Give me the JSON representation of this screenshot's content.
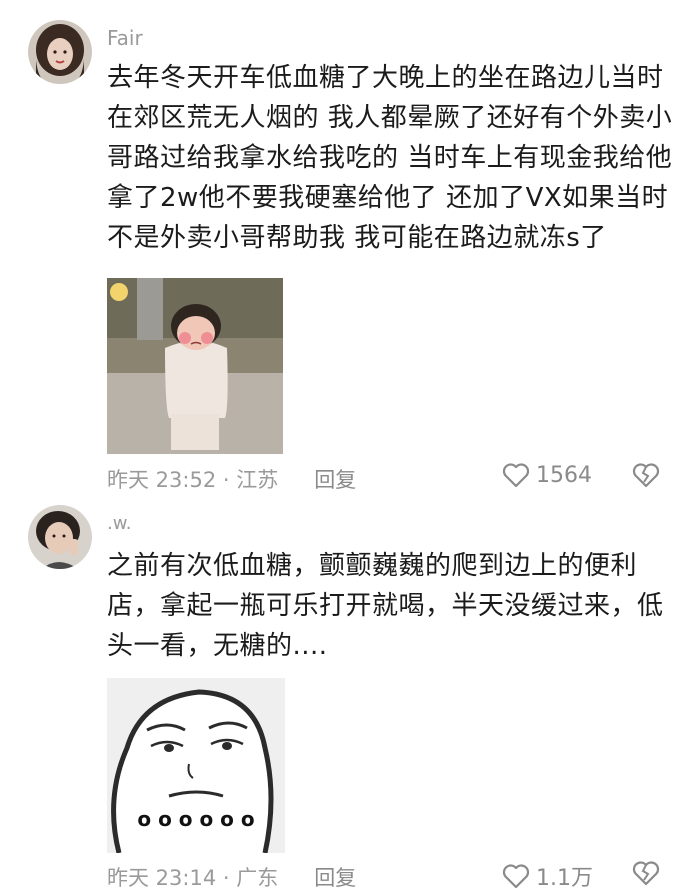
{
  "comments": [
    {
      "username": "Fair",
      "lines": [
        "去年冬天开车低血糖了大晚上的坐在路边儿当时",
        "在郊区荒无人烟的 我人都晕厥了还好有个外卖小",
        "哥路过给我拿水给我吃的 当时车上有现金我给他",
        "拿了2w他不要我硬塞给他了 还加了VX如果当时",
        "不是外卖小哥帮助我 我可能在路边就冻s了"
      ],
      "time": "昨天 23:52 · 江苏",
      "reply_label": "回复",
      "likes": "1564"
    },
    {
      "username": ".w.",
      "lines": [
        "之前有次低血糖，颤颤巍巍的爬到边上的便利",
        "店，拿起一瓶可乐打开就喝，半天没缓过来，低",
        "头一看，无糖的...."
      ],
      "time": "昨天 23:14 · 广东",
      "reply_label": "回复",
      "likes": "1.1万",
      "image_caption": "o o o o o o"
    }
  ],
  "colors": {
    "meta": "#9a9a9a",
    "text": "#1b1b1b"
  },
  "icons": [
    "heart-outline-icon",
    "broken-heart-icon"
  ]
}
